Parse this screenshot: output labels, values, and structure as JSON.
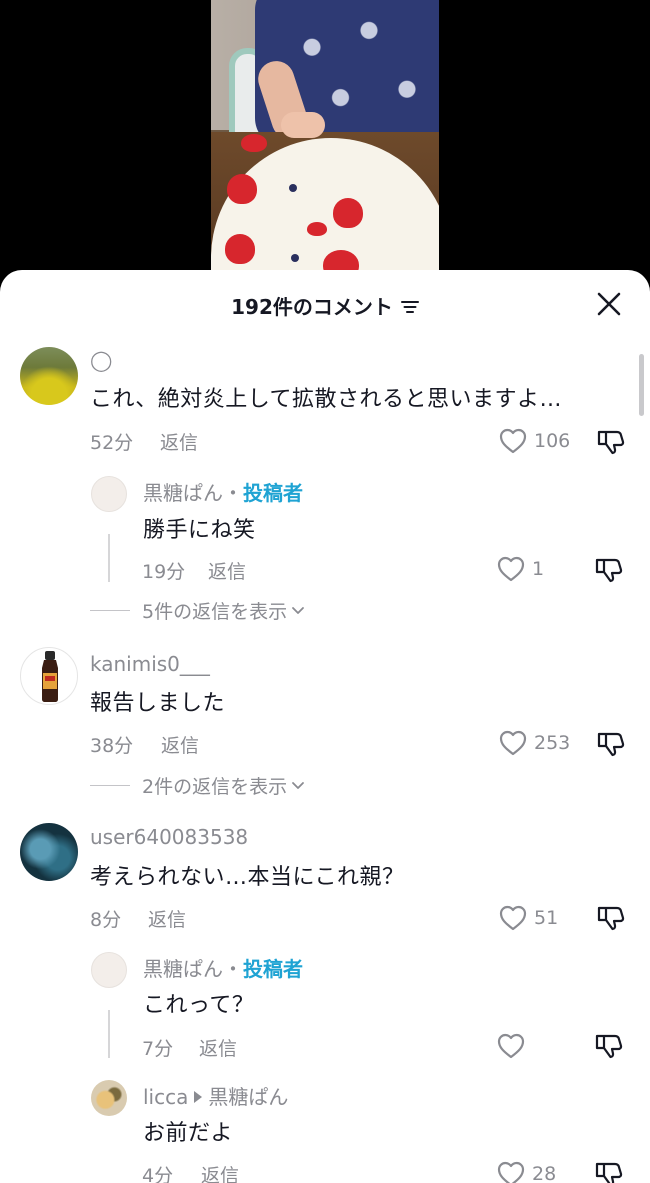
{
  "header": {
    "title": "192件のコメント",
    "filter_icon": "filter-lines-icon",
    "close_icon": "close-icon"
  },
  "comments": [
    {
      "username": "◯",
      "avatar": "yellow-flower-field-avatar",
      "text": "これ、絶対炎上して拡散されると思いますよ…",
      "time": "52分",
      "reply_label": "返信",
      "likes": "106",
      "replies": [
        {
          "username": "黒糖ぱん",
          "separator": "・",
          "author_badge": "投稿者",
          "text": "勝手にね笑",
          "time": "19分",
          "reply_label": "返信",
          "likes": "1"
        }
      ],
      "more_replies": "5件の返信を表示"
    },
    {
      "username": "kanimis0___",
      "avatar": "soy-sauce-bottle-avatar",
      "text": "報告しました",
      "time": "38分",
      "reply_label": "返信",
      "likes": "253",
      "more_replies": "2件の返信を表示"
    },
    {
      "username": "user640083538",
      "avatar": "blue-galaxy-avatar",
      "text": "考えられない…本当にこれ親？",
      "time": "8分",
      "reply_label": "返信",
      "likes": "51",
      "replies": [
        {
          "username": "黒糖ぱん",
          "separator": "・",
          "author_badge": "投稿者",
          "text": "これって？",
          "time": "7分",
          "reply_label": "返信",
          "likes": ""
        },
        {
          "username": "licca",
          "reply_to": "黒糖ぱん",
          "text": "お前だよ",
          "time": "4分",
          "reply_label": "返信",
          "likes": "28"
        }
      ]
    }
  ]
}
